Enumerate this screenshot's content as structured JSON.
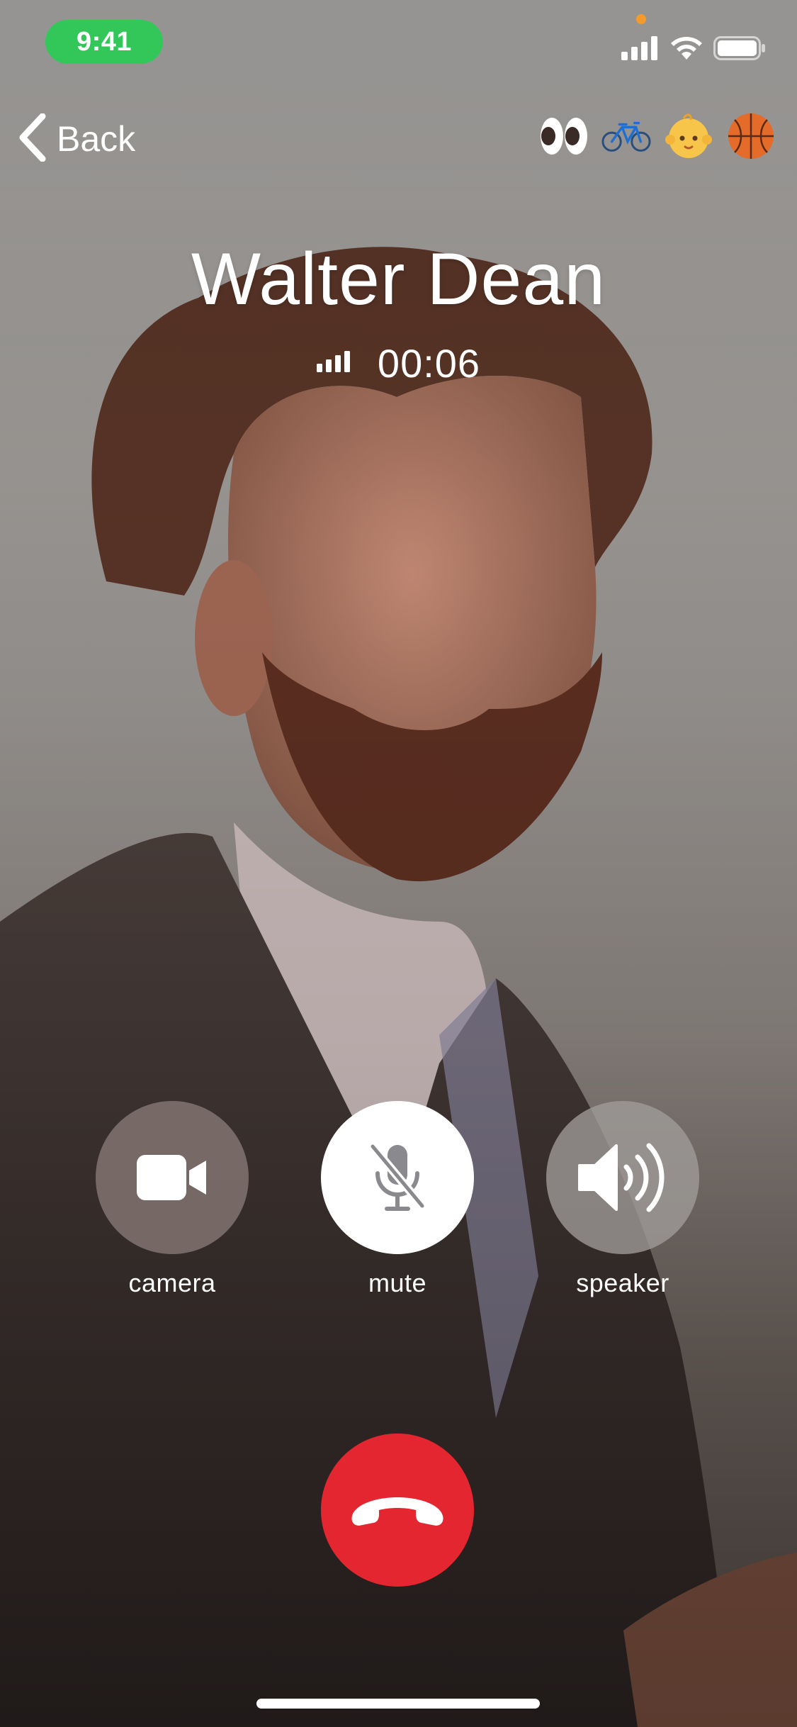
{
  "status_bar": {
    "time": "9:41",
    "icons": [
      "cellular-signal-icon",
      "wifi-icon",
      "battery-icon"
    ]
  },
  "nav": {
    "back_label": "Back",
    "reactions": [
      "👀",
      "🚲",
      "👶",
      "🏀"
    ]
  },
  "call": {
    "caller_name": "Walter Dean",
    "duration": "00:06",
    "signal_icon": "signal-strength-icon"
  },
  "controls": {
    "camera_label": "camera",
    "mute_label": "mute",
    "speaker_label": "speaker",
    "end_call_icon": "phone-hangup-icon"
  },
  "colors": {
    "time_pill": "#33c659",
    "end_call": "#e3262f",
    "mute_active": "#ffffff"
  }
}
